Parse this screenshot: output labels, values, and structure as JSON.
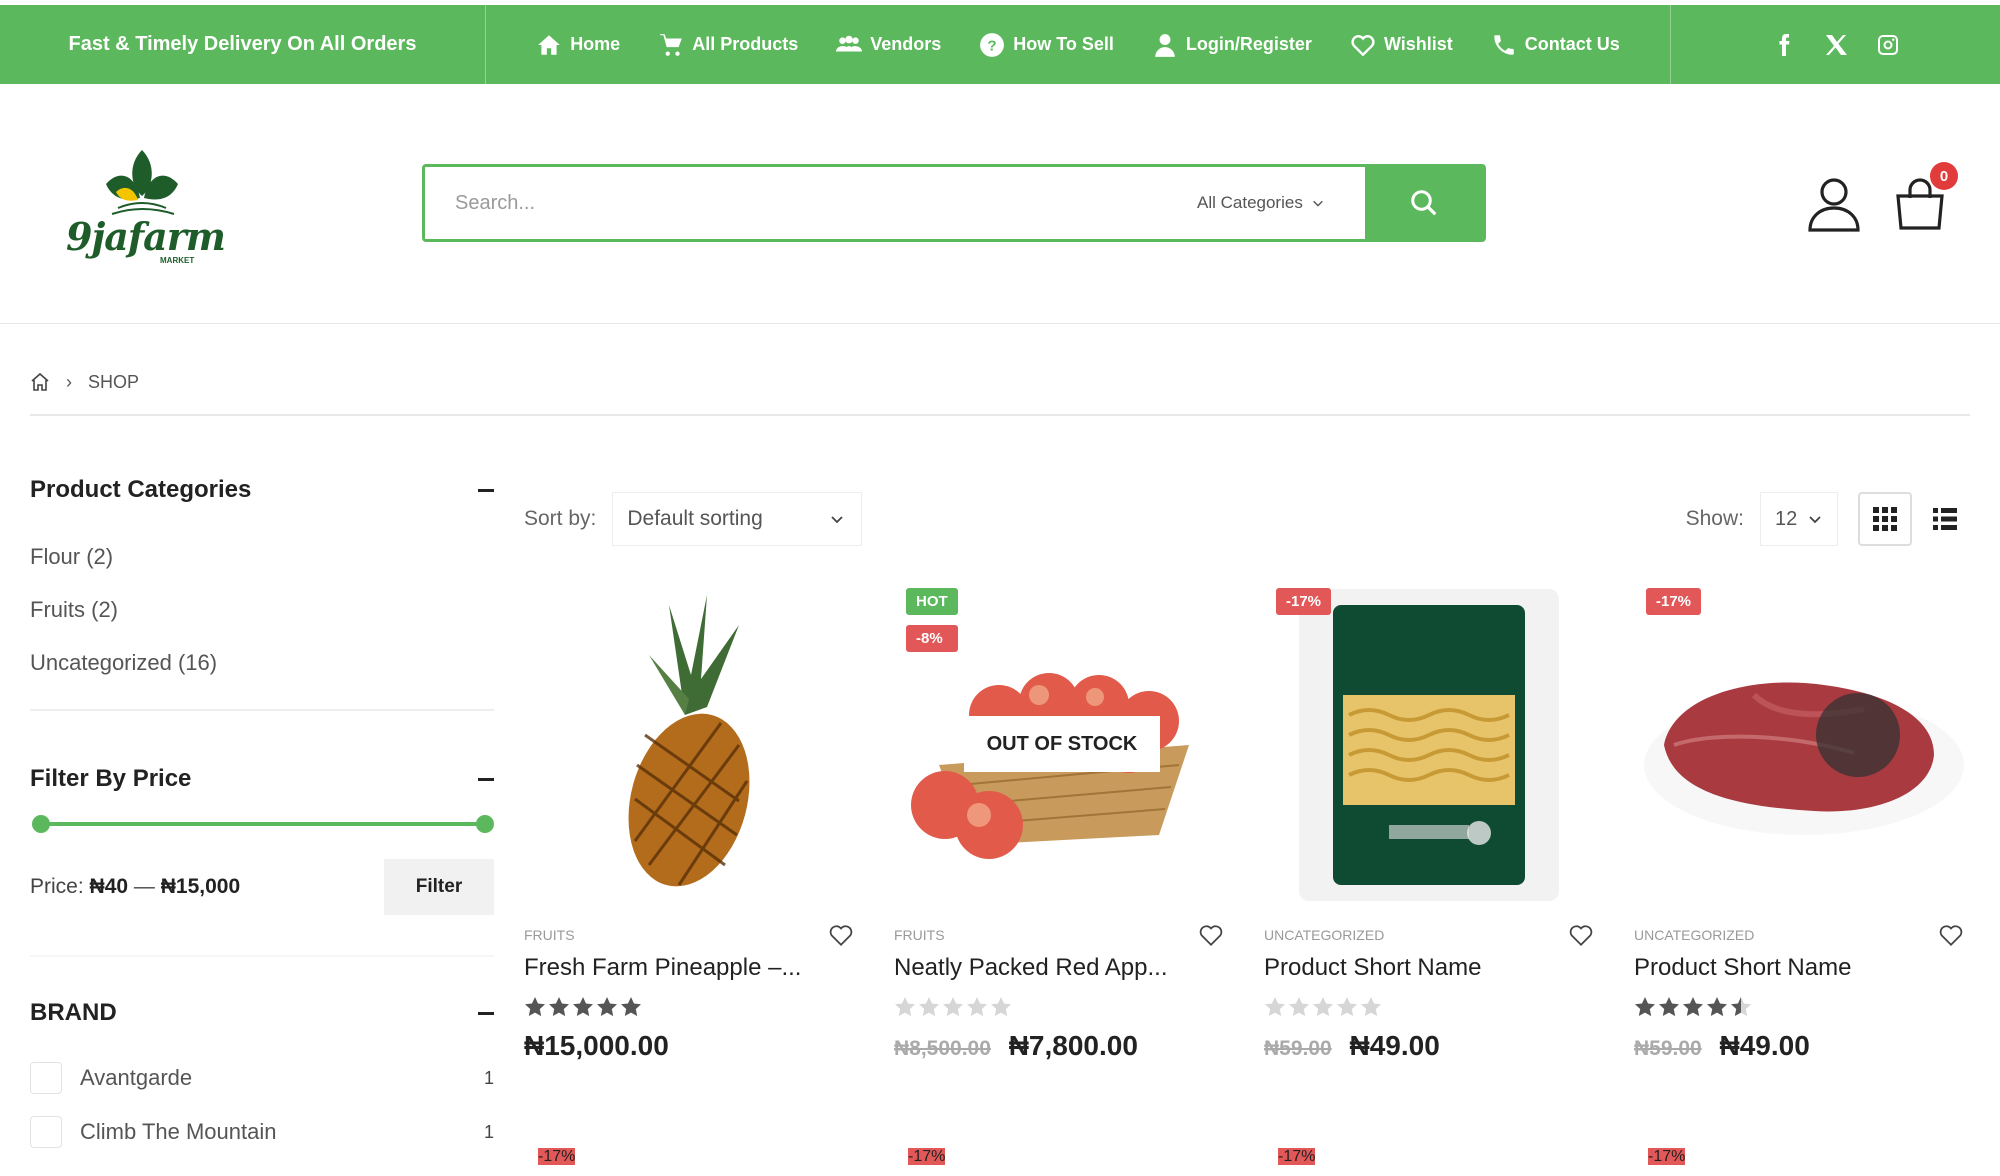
{
  "topbar": {
    "promo": "Fast & Timely Delivery On All Orders",
    "nav": [
      {
        "label": "Home",
        "icon": "home-icon"
      },
      {
        "label": "All Products",
        "icon": "cart-icon"
      },
      {
        "label": "Vendors",
        "icon": "users-icon"
      },
      {
        "label": "How To Sell",
        "icon": "question-icon"
      },
      {
        "label": "Login/Register",
        "icon": "user-icon"
      },
      {
        "label": "Wishlist",
        "icon": "heart-icon"
      },
      {
        "label": "Contact Us",
        "icon": "phone-icon"
      }
    ],
    "social": [
      "facebook-icon",
      "x-icon",
      "instagram-icon"
    ]
  },
  "header": {
    "logo_text": "9jafarm",
    "logo_sub": "MARKET",
    "search_placeholder": "Search...",
    "category_select": "All Categories",
    "cart_count": "0"
  },
  "breadcrumb": {
    "current": "SHOP"
  },
  "sidebar": {
    "categories_title": "Product Categories",
    "categories": [
      "Flour (2)",
      "Fruits (2)",
      "Uncategorized (16)"
    ],
    "price_title": "Filter By Price",
    "price_label": "Price:",
    "price_min": "₦40",
    "price_sep": "—",
    "price_max": "₦15,000",
    "filter_button": "Filter",
    "brand_title": "BRAND",
    "brands": [
      {
        "name": "Avantgarde",
        "count": "1"
      },
      {
        "name": "Climb The Mountain",
        "count": "1"
      }
    ]
  },
  "toolbar": {
    "sort_label": "Sort by:",
    "sort_value": "Default sorting",
    "show_label": "Show:",
    "show_value": "12"
  },
  "products": [
    {
      "category": "FRUITS",
      "title": "Fresh Farm Pineapple –...",
      "rating": 5,
      "old_price": "",
      "price": "₦15,000.00",
      "labels": [],
      "out_of_stock": false
    },
    {
      "category": "FRUITS",
      "title": "Neatly Packed Red App...",
      "rating": 0,
      "old_price": "₦8,500.00",
      "price": "₦7,800.00",
      "labels": [
        "HOT",
        "-8%"
      ],
      "out_of_stock": true,
      "stock_text": "OUT OF STOCK"
    },
    {
      "category": "UNCATEGORIZED",
      "title": "Product Short Name",
      "rating": 0,
      "old_price": "₦59.00",
      "price": "₦49.00",
      "labels": [
        "-17%"
      ],
      "out_of_stock": false
    },
    {
      "category": "UNCATEGORIZED",
      "title": "Product Short Name",
      "rating": 4.5,
      "old_price": "₦59.00",
      "price": "₦49.00",
      "labels": [
        "-17%"
      ],
      "out_of_stock": false
    }
  ],
  "row2_labels": [
    "-17%",
    "-17%",
    "-17%",
    "-17%"
  ],
  "colors": {
    "brand_green": "#5cb85c",
    "sale_red": "#e25757",
    "logo_green": "#1e5c2a"
  }
}
